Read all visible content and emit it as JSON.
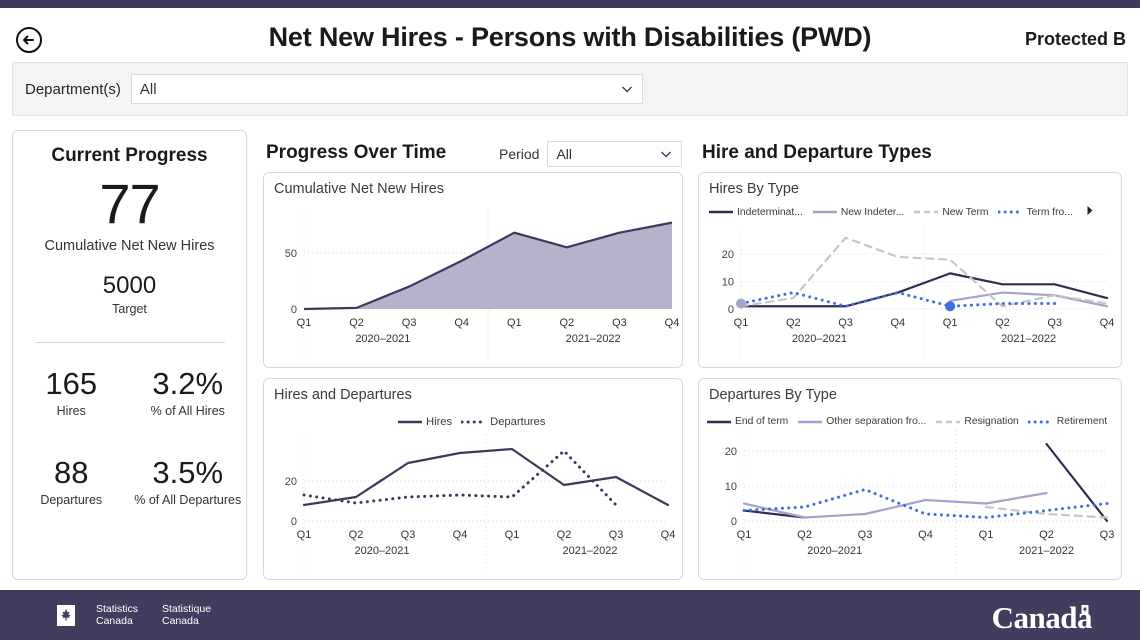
{
  "header": {
    "back_icon": "back-arrow-circle-icon",
    "title": "Net New Hires - Persons with Disabilities (PWD)",
    "classification": "Protected B"
  },
  "filters": {
    "department_label": "Department(s)",
    "department_value": "All",
    "department_chevron": "chevron-down-icon",
    "period_label": "Period",
    "period_value": "All",
    "period_chevron": "chevron-down-icon"
  },
  "current_progress": {
    "title": "Current Progress",
    "big_value": "77",
    "big_caption": "Cumulative Net New Hires",
    "target_value": "5000",
    "target_label": "Target",
    "stats": [
      {
        "value": "165",
        "label": "Hires"
      },
      {
        "value": "3.2%",
        "label": "% of All Hires"
      },
      {
        "value": "88",
        "label": "Departures"
      },
      {
        "value": "3.5%",
        "label": "% of All Departures"
      }
    ]
  },
  "sections": {
    "progress_over_time": "Progress Over Time",
    "hire_departure_types": "Hire and Departure Types"
  },
  "colors": {
    "brand_purple": "#413d5e",
    "accent_dark": "#3f3b5b",
    "series_dark": "#3b3a5e",
    "series_light": "#a5a3cc",
    "series_grey": "#c6c6c6",
    "series_blue": "#3f6fe0",
    "area_fill": "#a8a6c0"
  },
  "chart_data": [
    {
      "id": "cumulative-net-new-hires",
      "type": "area",
      "title": "Cumulative Net New Hires",
      "categories": [
        "Q1",
        "Q2",
        "Q3",
        "Q4",
        "Q1",
        "Q2",
        "Q3",
        "Q4"
      ],
      "group_labels": [
        "2020–2021",
        "2021–2022"
      ],
      "values": [
        0,
        1,
        20,
        43,
        68,
        55,
        68,
        77
      ],
      "yticks": [
        0,
        50
      ],
      "ylim": [
        0,
        82
      ],
      "grid": true,
      "legend": "none"
    },
    {
      "id": "hires-and-departures",
      "type": "line",
      "title": "Hires and Departures",
      "categories": [
        "Q1",
        "Q2",
        "Q3",
        "Q4",
        "Q1",
        "Q2",
        "Q3",
        "Q4"
      ],
      "group_labels": [
        "2020–2021",
        "2021–2022"
      ],
      "series": [
        {
          "name": "Hires",
          "style": "solid",
          "color": "#3b3a5e",
          "values": [
            8,
            12,
            29,
            34,
            36,
            18,
            22,
            8
          ]
        },
        {
          "name": "Departures",
          "style": "dotted",
          "color": "#3b3a5e",
          "values": [
            13,
            9,
            12,
            13,
            12,
            35,
            8,
            null
          ]
        }
      ],
      "yticks": [
        0,
        20
      ],
      "ylim": [
        0,
        40
      ],
      "grid": true,
      "legend": "top-center"
    },
    {
      "id": "hires-by-type",
      "type": "line",
      "title": "Hires By Type",
      "categories": [
        "Q1",
        "Q2",
        "Q3",
        "Q4",
        "Q1",
        "Q2",
        "Q3",
        "Q4"
      ],
      "group_labels": [
        "2020–2021",
        "2021–2022"
      ],
      "series": [
        {
          "name": "Indeterminat...",
          "style": "solid",
          "color": "#2f2e52",
          "values": [
            1,
            1,
            1,
            6,
            13,
            9,
            9,
            4
          ]
        },
        {
          "name": "New Indeter...",
          "style": "solid",
          "color": "#a5a3cc",
          "values": [
            2,
            null,
            null,
            null,
            3,
            6,
            5,
            1
          ]
        },
        {
          "name": "New Term",
          "style": "dashed",
          "color": "#c6c6c6",
          "values": [
            1,
            4,
            26,
            19,
            18,
            1,
            5,
            2
          ]
        },
        {
          "name": "Term fro...",
          "style": "dotted",
          "color": "#3f6fe0",
          "values": [
            2,
            6,
            1,
            6,
            1,
            2,
            2,
            null
          ]
        }
      ],
      "yticks": [
        0,
        10,
        20
      ],
      "ylim": [
        0,
        27
      ],
      "grid": true,
      "legend": "top-left",
      "legend_overflow_icon": "chevron-right-icon"
    },
    {
      "id": "departures-by-type",
      "type": "line",
      "title": "Departures By Type",
      "categories": [
        "Q1",
        "Q2",
        "Q3",
        "Q4",
        "Q1",
        "Q2",
        "Q3"
      ],
      "group_labels": [
        "2020–2021",
        "2021–2022"
      ],
      "series": [
        {
          "name": "End of term",
          "style": "solid",
          "color": "#2f2e52",
          "values": [
            3,
            1,
            null,
            null,
            null,
            22,
            0
          ]
        },
        {
          "name": "Other separation fro...",
          "style": "solid",
          "color": "#a5a3cc",
          "values": [
            5,
            1,
            2,
            6,
            5,
            8,
            null
          ]
        },
        {
          "name": "Resignation",
          "style": "dashed",
          "color": "#c6c6c6",
          "values": [
            null,
            null,
            null,
            null,
            4,
            2,
            1
          ]
        },
        {
          "name": "Retirement",
          "style": "dotted",
          "color": "#3f6fe0",
          "values": [
            3,
            4,
            9,
            2,
            1,
            3,
            5
          ]
        }
      ],
      "yticks": [
        0,
        10,
        20
      ],
      "ylim": [
        0,
        24
      ],
      "grid": true,
      "legend": "top-left"
    }
  ],
  "footer": {
    "flag_icon": "canada-flag-icon",
    "agency_en_line1": "Statistics",
    "agency_en_line2": "Canada",
    "agency_fr_line1": "Statistique",
    "agency_fr_line2": "Canada",
    "wordmark": "Canada"
  }
}
